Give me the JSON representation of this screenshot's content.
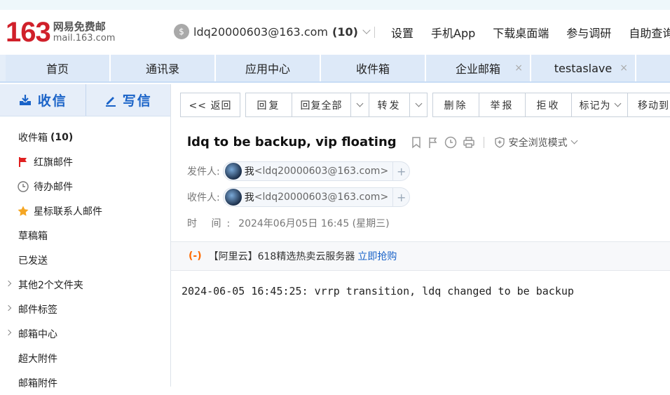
{
  "header": {
    "logo_number": "163",
    "logo_cn": "网易免费邮",
    "logo_domain": "mail.163.com",
    "account_email": "ldq20000603@163.com",
    "account_unread": "(10)",
    "links": [
      "设置",
      "手机App",
      "下载桌面端",
      "参与调研",
      "自助查询"
    ]
  },
  "nav": {
    "tabs": [
      {
        "label": "首页",
        "closable": false
      },
      {
        "label": "通讯录",
        "closable": false
      },
      {
        "label": "应用中心",
        "closable": false
      },
      {
        "label": "收件箱",
        "closable": false
      },
      {
        "label": "企业邮箱",
        "closable": true
      },
      {
        "label": "testaslave",
        "closable": true
      }
    ],
    "close_glyph": "×"
  },
  "sidebar": {
    "receive_label": "收信",
    "compose_label": "写信",
    "folders": [
      {
        "label": "收件箱",
        "count": "(10)",
        "icon": "none"
      },
      {
        "label": "红旗邮件",
        "icon": "red-flag-icon"
      },
      {
        "label": "待办邮件",
        "icon": "clock-icon"
      },
      {
        "label": "星标联系人邮件",
        "icon": "star-icon"
      },
      {
        "label": "草稿箱",
        "icon": "none"
      },
      {
        "label": "已发送",
        "icon": "none"
      },
      {
        "label": "其他2个文件夹",
        "icon": "expand-arrow"
      },
      {
        "label": "邮件标签",
        "icon": "expand-arrow"
      },
      {
        "label": "邮箱中心",
        "icon": "expand-arrow"
      },
      {
        "label": "超大附件",
        "icon": "none"
      },
      {
        "label": "邮箱附件",
        "icon": "none"
      }
    ]
  },
  "toolbar": {
    "back": "<< 返回",
    "reply": "回复",
    "reply_all": "回复全部",
    "forward": "转发",
    "delete": "删除",
    "report": "举报",
    "reject": "拒收",
    "mark_as": "标记为",
    "move_to": "移动到"
  },
  "mail": {
    "subject": "ldq to be backup, vip floating",
    "safe_mode": "安全浏览模式",
    "from_label": "发件人:",
    "to_label": "收件人:",
    "time_label": "时 间:",
    "from_name": "我",
    "from_addr": "<ldq20000603@163.com>",
    "to_name": "我",
    "to_addr": "<ldq20000603@163.com>",
    "time_value": "2024年06月05日 16:45 (星期三)",
    "plus": "+",
    "body": "2024-06-05 16:45:25: vrrp transition, ldq changed to be backup"
  },
  "ad": {
    "logo": "(-)",
    "text": "【阿里云】618精选热卖云服务器",
    "link": "立即抢购"
  },
  "colors": {
    "accent": "#1a63c8",
    "nav_bg": "#e5eef9",
    "brand_red": "#d0202a",
    "flag_red": "#e02020",
    "star_gold": "#f5a623"
  }
}
